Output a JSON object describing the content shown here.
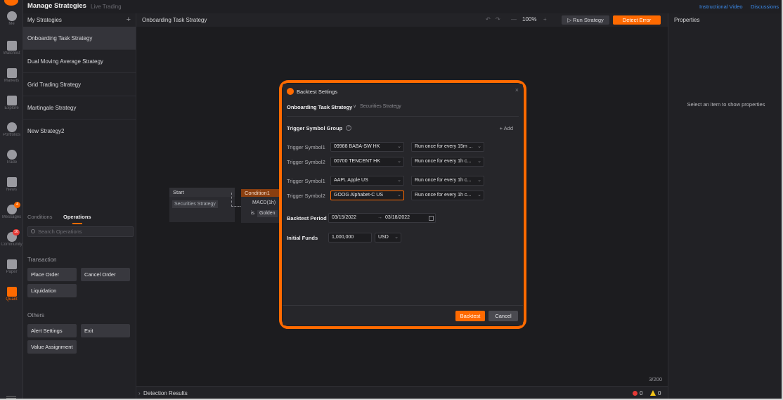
{
  "rail": {
    "items": [
      {
        "label": "Me",
        "icon": "person-icon"
      },
      {
        "label": "Watchlist",
        "icon": "watchlist-icon"
      },
      {
        "label": "Markets",
        "icon": "markets-icon"
      },
      {
        "label": "Explore",
        "icon": "explore-icon"
      },
      {
        "label": "Portfolios",
        "icon": "portfolio-icon"
      },
      {
        "label": "Trade",
        "icon": "trade-icon"
      },
      {
        "label": "News",
        "icon": "news-icon"
      },
      {
        "label": "Messages",
        "icon": "messages-icon",
        "badge": "4"
      },
      {
        "label": "Community",
        "icon": "community-icon",
        "badge": "10"
      },
      {
        "label": "Paper",
        "icon": "paper-icon"
      },
      {
        "label": "Quant",
        "icon": "quant-icon",
        "active": true
      }
    ]
  },
  "topbar": {
    "title": "Manage Strategies",
    "subtitle": "Live Trading",
    "links": [
      "Instructional Video",
      "Discussions"
    ]
  },
  "strategies": {
    "header": "My Strategies",
    "add": "+",
    "items": [
      "Onboarding Task Strategy",
      "Dual Moving Average Strategy",
      "Grid Trading Strategy",
      "Martingale Strategy",
      "New Strategy2"
    ],
    "selected_index": 0
  },
  "operations": {
    "tabs": [
      "Conditions",
      "Operations"
    ],
    "active_tab": "Operations",
    "search_placeholder": "Search Operations",
    "sections": [
      {
        "title": "Transaction",
        "buttons": [
          "Place Order",
          "Cancel Order",
          "Liquidation"
        ]
      },
      {
        "title": "Others",
        "buttons": [
          "Alert Settings",
          "Exit",
          "Value Assignment"
        ]
      }
    ]
  },
  "canvas": {
    "title": "Onboarding Task Strategy",
    "undo": "↶",
    "redo": "↷",
    "zoom_out": "—",
    "zoom": "100%",
    "zoom_in": "+",
    "run_label": "▷ Run Strategy",
    "detect_label": "Detect Error",
    "start_node": {
      "title": "Start",
      "tag": "Securities Strategy"
    },
    "condition_node": {
      "title": "Condition1",
      "line1": "MACD(1h)",
      "is": "is",
      "tag": "Golden"
    },
    "counter": "3/200",
    "detection": {
      "chevron": "›",
      "label": "Detection Results",
      "errors": "0",
      "warnings": "0"
    }
  },
  "properties": {
    "title": "Properties",
    "empty": "Select an item to show properties"
  },
  "dialog": {
    "title": "Backtest Settings",
    "close": "×",
    "strategy": "Onboarding Task Strategy",
    "strategy_chevron": "∨",
    "strategy_type": "Securities Strategy",
    "trigger_group_label": "Trigger Symbol Group",
    "help": "?",
    "add": "+ Add",
    "groups": [
      [
        {
          "label": "Trigger Symbol1",
          "symbol": "09988  BABA-SW  HK",
          "freq": "Run once for every 15m ..."
        },
        {
          "label": "Trigger Symbol2",
          "symbol": "00700  TENCENT  HK",
          "freq": "Run once for every 1h c..."
        }
      ],
      [
        {
          "label": "Trigger Symbol1",
          "symbol": "AAPL  Apple  US",
          "freq": "Run once for every 1h c..."
        },
        {
          "label": "Trigger Symbol2",
          "symbol": "GOOG  Alphabet-C  US",
          "freq": "Run once for every 1h c...",
          "focused": true
        }
      ]
    ],
    "backtest_period_label": "Backtest Period",
    "start_date": "03/15/2022",
    "date_sep": "→",
    "end_date": "03/18/2022",
    "initial_funds_label": "Initial Funds",
    "initial_funds": "1,000,000",
    "currency": "USD",
    "backtest_btn": "Backtest",
    "cancel_btn": "Cancel"
  },
  "colors": {
    "accent": "#ff6a00",
    "link": "#3b8beb",
    "error": "#e53935",
    "warning": "#f5c518"
  }
}
